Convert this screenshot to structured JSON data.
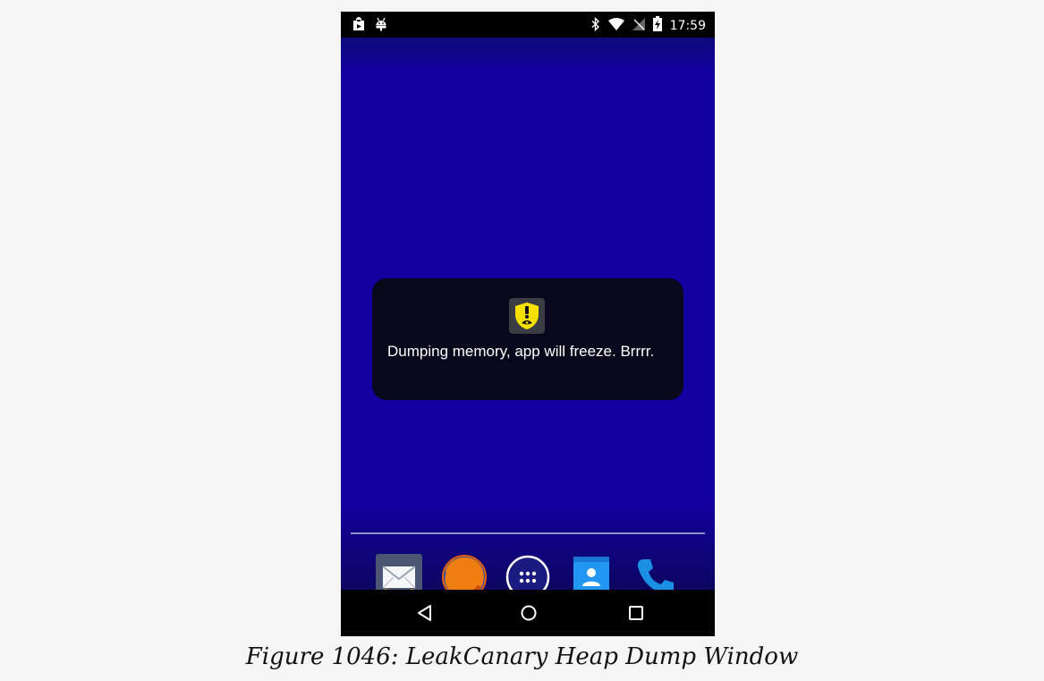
{
  "status_bar": {
    "time": "17:59",
    "left_icons": [
      "shopping-bag-icon",
      "android-icon"
    ],
    "right_icons": [
      "bluetooth-icon",
      "wifi-icon",
      "no-signal-icon",
      "battery-charging-icon"
    ]
  },
  "toast": {
    "icon": "leakcanary-icon",
    "message": "Dumping memory, app will freeze. Brrrr."
  },
  "dock": {
    "apps": [
      "email-app-icon",
      "firefox-app-icon",
      "app-drawer-icon",
      "contacts-app-icon",
      "phone-app-icon"
    ]
  },
  "nav_bar": {
    "buttons": [
      "back-icon",
      "home-icon",
      "recents-icon"
    ]
  },
  "caption": "Figure 1046: LeakCanary Heap Dump Window",
  "colors": {
    "wallpaper": "#1300a0",
    "toast_background": "#07081c",
    "leakcanary_yellow": "#f5e000",
    "phone_blue": "#1a8fe3"
  }
}
